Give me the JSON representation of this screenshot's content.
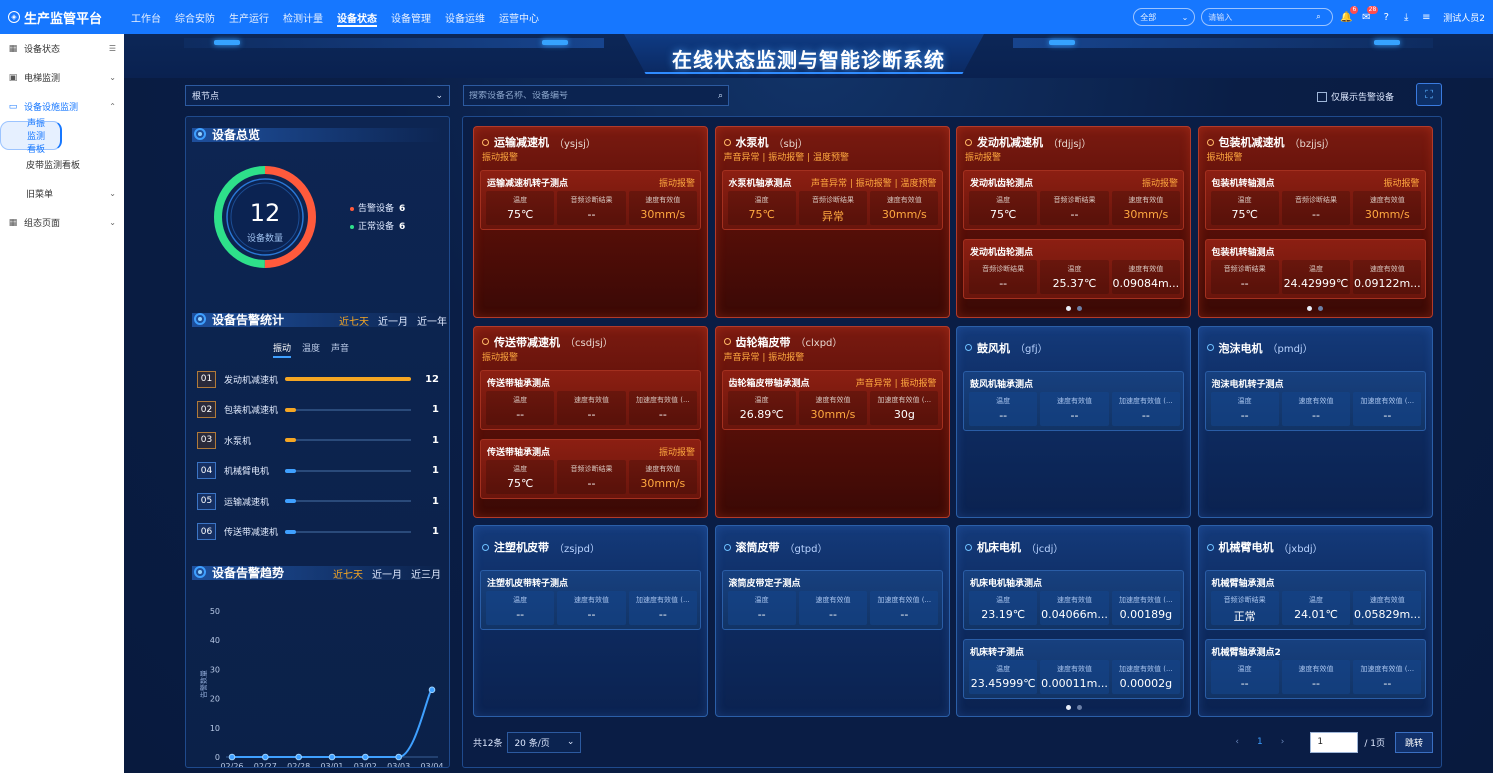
{
  "app": {
    "title": "生产监管平台"
  },
  "topnav": [
    "工作台",
    "综合安防",
    "生产运行",
    "检测计量",
    "设备状态",
    "设备管理",
    "设备运维",
    "运营中心"
  ],
  "topnav_active": 4,
  "topbar": {
    "scope": "全部",
    "search_placeholder": "请输入",
    "badge1": "6",
    "badge2": "28",
    "user": "测试人员2"
  },
  "sidebar": [
    {
      "label": "设备状态",
      "icon": "grid-icon"
    },
    {
      "label": "电梯监测",
      "icon": "elevator-icon"
    },
    {
      "label": "设备设施监测",
      "icon": "monitor-icon"
    },
    {
      "label": "声振监测看板"
    },
    {
      "label": "皮带监测看板"
    },
    {
      "label": "旧菜单"
    },
    {
      "label": "组态页面",
      "icon": "grid-icon"
    }
  ],
  "page": {
    "title": "在线状态监测与智能诊断系统",
    "node_select": "根节点",
    "search_placeholder": "搜索设备名称、设备编号",
    "only_alarm": "仅展示告警设备"
  },
  "overview": {
    "heading": "设备总览",
    "total": "12",
    "total_label": "设备数量",
    "alarm_label": "告警设备",
    "alarm_count": "6",
    "normal_label": "正常设备",
    "normal_count": "6",
    "alarm_color": "#ff5a3c",
    "normal_color": "#2ee08a",
    "alarm_fraction": 0.5
  },
  "stats": {
    "heading": "设备告警统计",
    "ranges": [
      "近七天",
      "近一月",
      "近一年"
    ],
    "tabs": [
      "振动",
      "温度",
      "声音"
    ],
    "rows": [
      {
        "no": "01",
        "name": "发动机减速机",
        "value": 12,
        "color": "#f5a623"
      },
      {
        "no": "02",
        "name": "包装机减速机",
        "value": 1,
        "color": "#f5a623"
      },
      {
        "no": "03",
        "name": "水泵机",
        "value": 1,
        "color": "#f5a623"
      },
      {
        "no": "04",
        "name": "机械臂电机",
        "value": 1,
        "color": "#3fa0ff"
      },
      {
        "no": "05",
        "name": "运输减速机",
        "value": 1,
        "color": "#3fa0ff"
      },
      {
        "no": "06",
        "name": "传送带减速机",
        "value": 1,
        "color": "#3fa0ff"
      }
    ]
  },
  "trend": {
    "heading": "设备告警趋势",
    "ranges": [
      "近七天",
      "近一月",
      "近三月"
    ]
  },
  "chart_data": {
    "type": "line",
    "x": [
      "02/26",
      "02/27",
      "02/28",
      "03/01",
      "03/02",
      "03/03",
      "03/04"
    ],
    "series": [
      {
        "values": [
          0,
          0,
          0,
          0,
          0,
          0,
          23
        ]
      }
    ],
    "ylabel": "告警数量",
    "ylim": [
      0,
      50
    ],
    "yticks": [
      0,
      10,
      20,
      30,
      40,
      50
    ]
  },
  "cards": [
    {
      "name": "运输减速机",
      "code": "ysjsj",
      "status": "alarm",
      "alarm": "振动报警",
      "points": [
        {
          "name": "运输减速机转子测点",
          "alarm": "振动报警",
          "metrics": [
            [
              "温度",
              "75℃",
              false
            ],
            [
              "音频诊断结果",
              "--",
              false
            ],
            [
              "速度有效值",
              "30mm/s",
              true
            ]
          ]
        }
      ]
    },
    {
      "name": "水泵机",
      "code": "sbj",
      "status": "alarm",
      "alarm": "声音异常 | 振动报警 | 温度预警",
      "points": [
        {
          "name": "水泵机轴承测点",
          "alarm": "声音异常 | 振动报警 | 温度预警",
          "metrics": [
            [
              "温度",
              "75℃",
              true
            ],
            [
              "音频诊断结果",
              "异常",
              true
            ],
            [
              "速度有效值",
              "30mm/s",
              true
            ]
          ]
        }
      ]
    },
    {
      "name": "发动机减速机",
      "code": "fdjjsj",
      "status": "alarm",
      "alarm": "振动报警",
      "dots": true,
      "points": [
        {
          "name": "发动机齿轮测点",
          "alarm": "振动报警",
          "metrics": [
            [
              "温度",
              "75℃",
              false
            ],
            [
              "音频诊断结果",
              "--",
              false
            ],
            [
              "速度有效值",
              "30mm/s",
              true
            ]
          ]
        },
        {
          "name": "发动机齿轮测点",
          "alarm": "",
          "metrics": [
            [
              "音频诊断结果",
              "--",
              false
            ],
            [
              "温度",
              "25.37℃",
              false
            ],
            [
              "速度有效值",
              "0.09084m...",
              false
            ]
          ]
        }
      ]
    },
    {
      "name": "包装机减速机",
      "code": "bzjjsj",
      "status": "alarm",
      "alarm": "振动报警",
      "dots": true,
      "points": [
        {
          "name": "包装机转轴测点",
          "alarm": "振动报警",
          "metrics": [
            [
              "温度",
              "75℃",
              false
            ],
            [
              "音频诊断结果",
              "--",
              false
            ],
            [
              "速度有效值",
              "30mm/s",
              true
            ]
          ]
        },
        {
          "name": "包装机转轴测点",
          "alarm": "",
          "metrics": [
            [
              "音频诊断结果",
              "--",
              false
            ],
            [
              "温度",
              "24.42999℃",
              false
            ],
            [
              "速度有效值",
              "0.09122m...",
              false
            ]
          ]
        }
      ]
    },
    {
      "name": "传送带减速机",
      "code": "csdjsj",
      "status": "alarm",
      "alarm": "振动报警",
      "points": [
        {
          "name": "传送带轴承测点",
          "alarm": "",
          "metrics": [
            [
              "温度",
              "--",
              false
            ],
            [
              "速度有效值",
              "--",
              false
            ],
            [
              "加速度有效值 (...",
              "--",
              false
            ]
          ]
        },
        {
          "name": "传送带轴承测点",
          "alarm": "振动报警",
          "metrics": [
            [
              "温度",
              "75℃",
              false
            ],
            [
              "音频诊断结果",
              "--",
              false
            ],
            [
              "速度有效值",
              "30mm/s",
              true
            ]
          ]
        }
      ]
    },
    {
      "name": "齿轮箱皮带",
      "code": "clxpd",
      "status": "alarm",
      "alarm": "声音异常 | 振动报警",
      "points": [
        {
          "name": "齿轮箱皮带轴承测点",
          "alarm": "声音异常 | 振动报警",
          "metrics": [
            [
              "温度",
              "26.89℃",
              false
            ],
            [
              "速度有效值",
              "30mm/s",
              true
            ],
            [
              "加速度有效值 (...",
              "30g",
              false
            ]
          ]
        }
      ]
    },
    {
      "name": "鼓风机",
      "code": "gfj",
      "status": "ok",
      "alarm": "",
      "points": [
        {
          "name": "鼓风机轴承测点",
          "alarm": "",
          "metrics": [
            [
              "温度",
              "--",
              false
            ],
            [
              "速度有效值",
              "--",
              false
            ],
            [
              "加速度有效值 (...",
              "--",
              false
            ]
          ]
        }
      ]
    },
    {
      "name": "泡沫电机",
      "code": "pmdj",
      "status": "ok",
      "alarm": "",
      "points": [
        {
          "name": "泡沫电机转子测点",
          "alarm": "",
          "metrics": [
            [
              "温度",
              "--",
              false
            ],
            [
              "速度有效值",
              "--",
              false
            ],
            [
              "加速度有效值 (...",
              "--",
              false
            ]
          ]
        }
      ]
    },
    {
      "name": "注塑机皮带",
      "code": "zsjpd",
      "status": "ok",
      "alarm": "",
      "points": [
        {
          "name": "注塑机皮带转子测点",
          "alarm": "",
          "metrics": [
            [
              "温度",
              "--",
              false
            ],
            [
              "速度有效值",
              "--",
              false
            ],
            [
              "加速度有效值 (...",
              "--",
              false
            ]
          ]
        }
      ]
    },
    {
      "name": "滚筒皮带",
      "code": "gtpd",
      "status": "ok",
      "alarm": "",
      "points": [
        {
          "name": "滚筒皮带定子测点",
          "alarm": "",
          "metrics": [
            [
              "温度",
              "--",
              false
            ],
            [
              "速度有效值",
              "--",
              false
            ],
            [
              "加速度有效值 (...",
              "--",
              false
            ]
          ]
        }
      ]
    },
    {
      "name": "机床电机",
      "code": "jcdj",
      "status": "ok",
      "alarm": "",
      "dots": true,
      "points": [
        {
          "name": "机床电机轴承测点",
          "alarm": "",
          "metrics": [
            [
              "温度",
              "23.19℃",
              false
            ],
            [
              "速度有效值",
              "0.04066m...",
              false
            ],
            [
              "加速度有效值 (...",
              "0.00189g",
              false
            ]
          ]
        },
        {
          "name": "机床转子测点",
          "alarm": "",
          "metrics": [
            [
              "温度",
              "23.45999℃",
              false
            ],
            [
              "速度有效值",
              "0.00011m...",
              false
            ],
            [
              "加速度有效值 (...",
              "0.00002g",
              false
            ]
          ]
        }
      ]
    },
    {
      "name": "机械臂电机",
      "code": "jxbdj",
      "status": "ok",
      "alarm": "",
      "points": [
        {
          "name": "机械臂轴承测点",
          "alarm": "",
          "metrics": [
            [
              "音频诊断结果",
              "正常",
              false
            ],
            [
              "温度",
              "24.01℃",
              false
            ],
            [
              "速度有效值",
              "0.05829m...",
              false
            ]
          ]
        },
        {
          "name": "机械臂轴承测点2",
          "alarm": "",
          "metrics": [
            [
              "温度",
              "--",
              false
            ],
            [
              "速度有效值",
              "--",
              false
            ],
            [
              "加速度有效值 (...",
              "--",
              false
            ]
          ]
        }
      ]
    }
  ],
  "pager": {
    "total": "共12条",
    "size": "20 条/页",
    "current": "1",
    "jump_value": "1",
    "pages": "/ 1页",
    "jump": "跳转",
    "prev": "‹",
    "next": "›"
  }
}
